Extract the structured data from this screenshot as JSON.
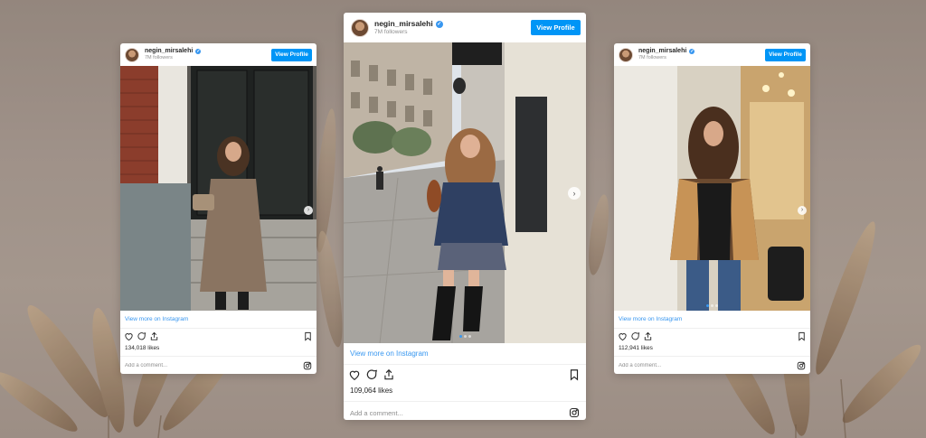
{
  "background": {
    "color": "#a0938a",
    "decor": "pampas-grass-icon"
  },
  "cards": [
    {
      "username": "negin_mirsalehi",
      "followers": "7M followers",
      "view_profile": "View Profile",
      "view_more": "View more on Instagram",
      "likes": "134,018 likes",
      "comment_placeholder": "Add a comment...",
      "photo_icon": "woman-in-coat-icon"
    },
    {
      "username": "negin_mirsalehi",
      "followers": "7M followers",
      "view_profile": "View Profile",
      "view_more": "View more on Instagram",
      "likes": "109,064 likes",
      "comment_placeholder": "Add a comment...",
      "photo_icon": "woman-on-street-icon"
    },
    {
      "username": "negin_mirsalehi",
      "followers": "7M followers",
      "view_profile": "View Profile",
      "view_more": "View more on Instagram",
      "likes": "112,941 likes",
      "comment_placeholder": "Add a comment...",
      "photo_icon": "woman-in-shearling-icon"
    }
  ],
  "colors": {
    "accent": "#0095f6",
    "link": "#3897f0",
    "text": "#262626",
    "muted": "#8e8e8e"
  }
}
